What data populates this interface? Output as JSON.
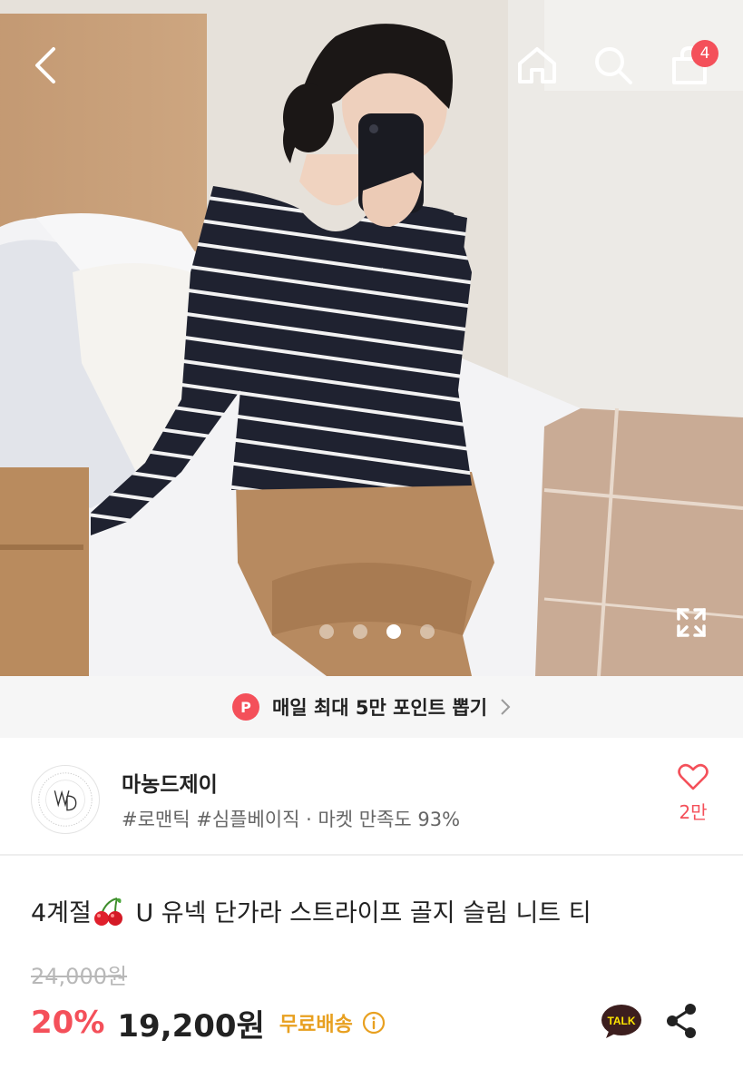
{
  "header": {
    "cart_count": "4",
    "carousel": {
      "total": 4,
      "active_index": 2
    }
  },
  "banner": {
    "badge": "P",
    "text": "매일 최대 5만 포인트 뽑기"
  },
  "store": {
    "name": "마농드제이",
    "tags": "#로맨틱 #심플베이직 · 마켓 만족도 93%",
    "likes": "2만"
  },
  "product": {
    "title_prefix": "4계절",
    "title_suffix": " U 유넥 단가라 스트라이프 골지 슬림 니트 티",
    "original_price": "24,000원",
    "discount": "20%",
    "price": "19,200원",
    "shipping": "무료배송",
    "talk_label": "TALK"
  },
  "colors": {
    "accent": "#f4505a",
    "shipping": "#e8a020",
    "talk": "#3c1e1e"
  },
  "icons": [
    "back-arrow-icon",
    "home-icon",
    "search-icon",
    "shopping-bag-icon",
    "expand-icon",
    "chevron-right-icon",
    "heart-icon",
    "cherry-icon",
    "info-icon",
    "talk-icon",
    "share-icon"
  ]
}
